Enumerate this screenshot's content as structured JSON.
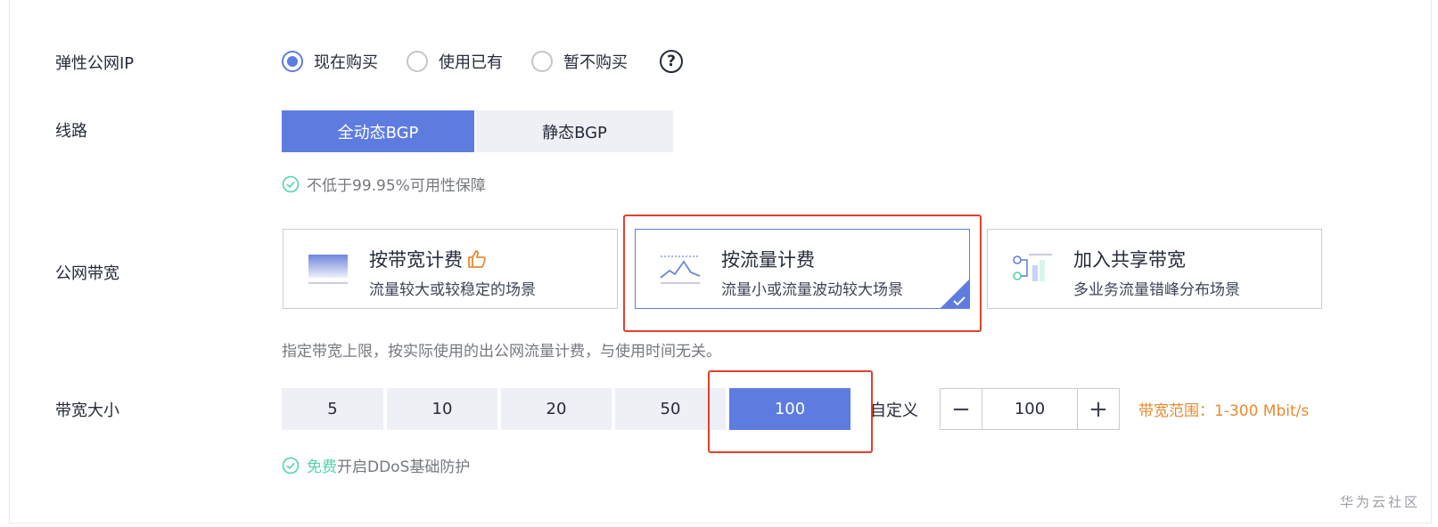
{
  "eip": {
    "label": "弹性公网IP",
    "options": [
      {
        "text": "现在购买",
        "checked": true
      },
      {
        "text": "使用已有",
        "checked": false
      },
      {
        "text": "暂不购买",
        "checked": false
      }
    ],
    "help": "?"
  },
  "route": {
    "label": "线路",
    "options": [
      {
        "text": "全动态BGP",
        "active": true
      },
      {
        "text": "静态BGP",
        "active": false
      }
    ],
    "note": "不低于99.95%可用性保障"
  },
  "billing": {
    "label": "公网带宽",
    "cards": [
      {
        "title": "按带宽计费",
        "desc": "流量较大或较稳定的场景",
        "icon": "bandwidth-gradient-icon",
        "badge_icon": "thumbs-up-icon",
        "selected": false
      },
      {
        "title": "按流量计费",
        "desc": "流量小或流量波动较大场景",
        "icon": "traffic-wave-icon",
        "selected": true
      },
      {
        "title": "加入共享带宽",
        "desc": "多业务流量错峰分布场景",
        "icon": "shared-bandwidth-icon",
        "selected": false
      }
    ],
    "note": "指定带宽上限，按实际使用的出公网流量计费，与使用时间无关。"
  },
  "size": {
    "label": "带宽大小",
    "options": [
      {
        "text": "5",
        "active": false
      },
      {
        "text": "10",
        "active": false
      },
      {
        "text": "20",
        "active": false
      },
      {
        "text": "50",
        "active": false
      },
      {
        "text": "100",
        "active": true
      }
    ],
    "custom_label": "自定义",
    "stepper_value": "100",
    "minus": "−",
    "plus": "+",
    "range_text": "带宽范围：1-300 Mbit/s",
    "note_free": "免费",
    "note_rest": "开启DDoS基础防护"
  },
  "colors": {
    "accent": "#5e7ce0",
    "highlight": "#e2402f",
    "success": "#50d4ab",
    "warning": "#e88a2f"
  },
  "watermark": "华为云社区"
}
